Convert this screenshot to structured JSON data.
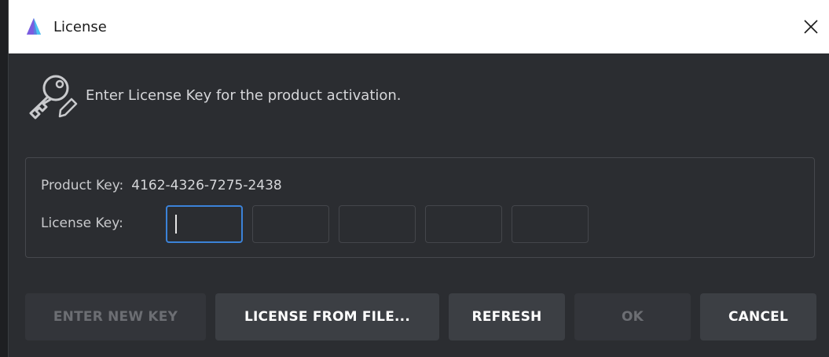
{
  "window": {
    "title": "License",
    "close_symbol": "✕"
  },
  "header": {
    "text": "Enter License Key for the product activation.",
    "icon": "key-icon"
  },
  "key_panel": {
    "product_label": "Product Key:",
    "product_value": "4162-4326-7275-2438",
    "license_label": "License Key:",
    "license_segments": [
      "",
      "",
      "",
      "",
      ""
    ]
  },
  "buttons": {
    "enter_new_key": "ENTER NEW KEY",
    "license_from_file": "LICENSE FROM FILE...",
    "refresh": "REFRESH",
    "ok": "OK",
    "cancel": "CANCEL"
  },
  "colors": {
    "background": "#2b2d31",
    "titlebar": "#ffffff",
    "focus": "#3b82d8",
    "button": "#3c3f44",
    "button_disabled": "#33353a"
  }
}
